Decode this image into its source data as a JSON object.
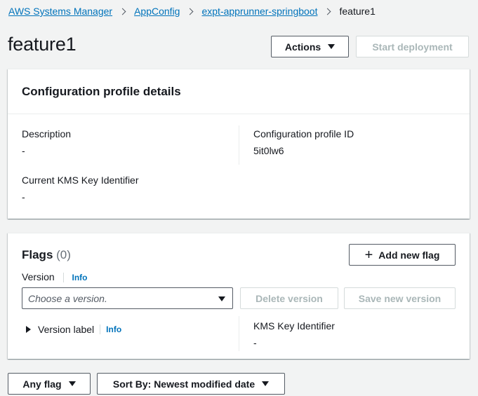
{
  "breadcrumb": {
    "items": [
      "AWS Systems Manager",
      "AppConfig",
      "expt-apprunner-springboot"
    ],
    "current": "feature1"
  },
  "title": "feature1",
  "header_actions": {
    "actions_label": "Actions",
    "start_deployment_label": "Start deployment"
  },
  "details": {
    "heading": "Configuration profile details",
    "description_label": "Description",
    "description_value": "-",
    "profile_id_label": "Configuration profile ID",
    "profile_id_value": "5it0lw6",
    "kms_label": "Current KMS Key Identifier",
    "kms_value": "-"
  },
  "flags": {
    "heading": "Flags",
    "count": "(0)",
    "add_label": "Add new flag",
    "version_label": "Version",
    "info": "Info",
    "version_placeholder": "Choose a version.",
    "delete_version_label": "Delete version",
    "save_version_label": "Save new version",
    "version_label_toggle": "Version label",
    "kms_label": "KMS Key Identifier",
    "kms_value": "-"
  },
  "filters": {
    "flag_filter": "Any flag",
    "sort": "Sort By: Newest modified date"
  },
  "colors": {
    "link": "#0073bb",
    "background": "#f2f3f3",
    "disabled_text": "#aab7b8"
  }
}
